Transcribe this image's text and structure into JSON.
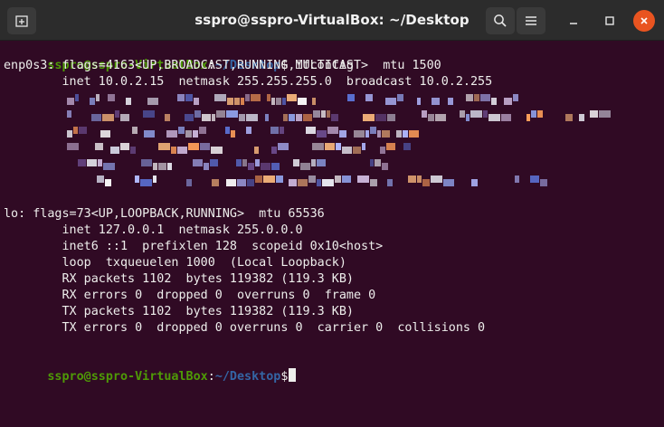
{
  "window": {
    "title": "sspro@sspro-VirtualBox: ~/Desktop",
    "colors": {
      "terminal_bg": "#300a24",
      "titlebar_bg": "#2c2c2c",
      "prompt_user": "#4e9a06",
      "prompt_path": "#3465a4",
      "close_accent": "#e95420"
    },
    "icons": [
      "new-tab-icon",
      "search-icon",
      "hamburger-menu-icon",
      "minimize-icon",
      "maximize-icon",
      "close-icon"
    ]
  },
  "prompt": {
    "user_host": "sspro@sspro-VirtualBox",
    "sep": ":",
    "path": "~/Desktop",
    "symbol": "$"
  },
  "command": " ifconfig",
  "enp0s3": {
    "header": "enp0s3: flags=4163<UP,BROADCAST,RUNNING,MULTICAST>  mtu 1500",
    "inet": "        inet 10.0.2.15  netmask 255.255.255.0  broadcast 10.0.2.255"
  },
  "lo": {
    "header": "lo: flags=73<UP,LOOPBACK,RUNNING>  mtu 65536",
    "lines": [
      "        inet 127.0.0.1  netmask 255.0.0.0",
      "        inet6 ::1  prefixlen 128  scopeid 0x10<host>",
      "        loop  txqueuelen 1000  (Local Loopback)",
      "        RX packets 1102  bytes 119382 (119.3 KB)",
      "        RX errors 0  dropped 0  overruns 0  frame 0",
      "        TX packets 1102  bytes 119382 (119.3 KB)",
      "        TX errors 0  dropped 0 overruns 0  carrier 0  collisions 0"
    ]
  }
}
